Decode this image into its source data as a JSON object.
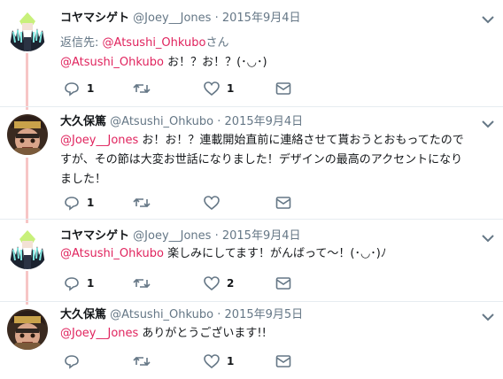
{
  "tweets": [
    {
      "name": "コヤマシゲト",
      "handle": "@Joey__Jones",
      "dot": "·",
      "date": "2015年9月4日",
      "reply_label": "返信先:",
      "reply_handle": "@Atsushi_Ohkubo",
      "reply_suffix": "さん",
      "mention": "@Atsushi_Ohkubo",
      "text": " お！？お！？(･◡･)",
      "reply_count": "1",
      "retweet_count": "",
      "like_count": "1"
    },
    {
      "name": "大久保篤",
      "handle": "@Atsushi_Ohkubo",
      "dot": "·",
      "date": "2015年9月4日",
      "mention": "@Joey__Jones",
      "text_line1": " お！お！？連載開始直前に連絡させて貰おうとおもってたので",
      "text_line2": "すが、その節は大変お世話になりました！デザインの最高のアクセントになり",
      "text_line3": "ました！",
      "reply_count": "1",
      "retweet_count": "",
      "like_count": ""
    },
    {
      "name": "コヤマシゲト",
      "handle": "@Joey__Jones",
      "dot": "·",
      "date": "2015年9月4日",
      "mention": "@Atsushi_Ohkubo",
      "text": " 楽しみにしてます！がんばって〜！(･◡･)ﾉ",
      "reply_count": "1",
      "retweet_count": "",
      "like_count": "2"
    },
    {
      "name": "大久保篤",
      "handle": "@Atsushi_Ohkubo",
      "dot": "·",
      "date": "2015年9月5日",
      "mention": "@Joey__Jones",
      "text": " ありがとうございます!!",
      "reply_count": "",
      "retweet_count": "",
      "like_count": "1"
    }
  ],
  "icons": {
    "reply": "reply-icon",
    "retweet": "retweet-icon",
    "like": "heart-icon",
    "dm": "envelope-icon",
    "more": "chevron-down-icon"
  },
  "colors": {
    "mention": "#e0245e",
    "thread_line": "#f7c6c6",
    "muted": "#657786"
  }
}
